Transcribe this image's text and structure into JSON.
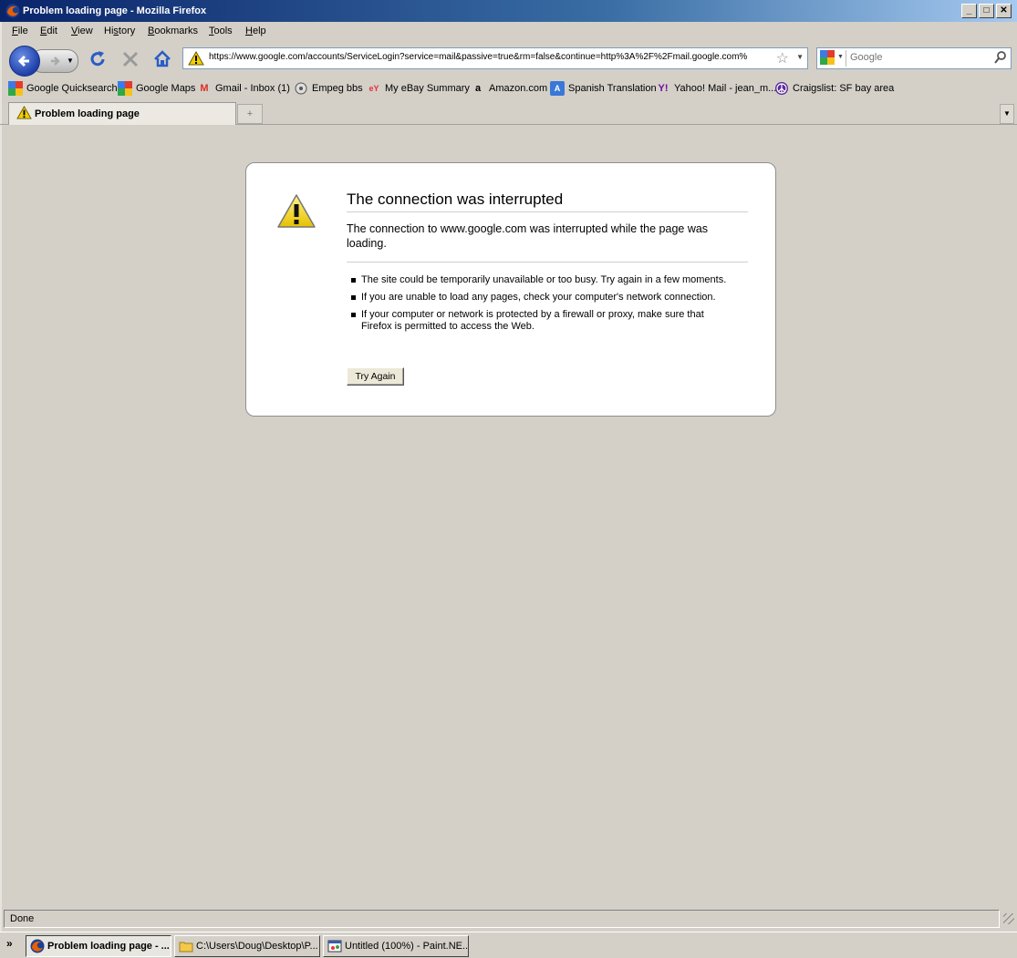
{
  "window": {
    "title": "Problem loading page - Mozilla Firefox"
  },
  "menu": [
    "File",
    "Edit",
    "View",
    "History",
    "Bookmarks",
    "Tools",
    "Help"
  ],
  "menu_accel": [
    "F",
    "E",
    "V",
    "s",
    "B",
    "T",
    "H"
  ],
  "navbar": {
    "url": "https://www.google.com/accounts/ServiceLogin?service=mail&passive=true&rm=false&continue=http%3A%2F%2Fmail.google.com%2",
    "search_placeholder": "Google"
  },
  "bookmarks": [
    {
      "label": "Google Quicksearch",
      "icon": "google-icon"
    },
    {
      "label": "Google Maps",
      "icon": "google-icon"
    },
    {
      "label": "Gmail - Inbox (1)",
      "icon": "gmail-icon"
    },
    {
      "label": "Empeg bbs",
      "icon": "empeg-icon"
    },
    {
      "label": "My eBay Summary",
      "icon": "ebay-icon"
    },
    {
      "label": "Amazon.com",
      "icon": "amazon-icon"
    },
    {
      "label": "Spanish Translation",
      "icon": "translate-icon"
    },
    {
      "label": "Yahoo! Mail - jean_m...",
      "icon": "yahoo-icon"
    },
    {
      "label": "Craigslist: SF bay area",
      "icon": "peace-icon"
    }
  ],
  "tabs": [
    {
      "label": "Problem loading page",
      "active": true
    }
  ],
  "error": {
    "title": "The connection was interrupted",
    "short": "The connection to www.google.com was interrupted while the page was loading.",
    "bullets": [
      "The site could be temporarily unavailable or too busy. Try again in a few moments.",
      "If you are unable to load any pages, check your computer's network connection.",
      "If your computer or network is protected by a firewall or proxy, make sure that Firefox is permitted to access the Web."
    ],
    "button": "Try Again"
  },
  "status": {
    "text": "Done"
  },
  "taskbar": [
    {
      "label": "Problem loading page - ...",
      "active": true,
      "icon": "firefox-icon"
    },
    {
      "label": "C:\\Users\\Doug\\Desktop\\P...",
      "active": false,
      "icon": "folder-icon"
    },
    {
      "label": "Untitled (100%) - Paint.NE...",
      "active": false,
      "icon": "paint-icon"
    }
  ],
  "colors": {
    "titlebar_start": "#0a246a",
    "titlebar_end": "#a6caf0",
    "chrome": "#d4d0c8",
    "warning": "#f0d000"
  }
}
